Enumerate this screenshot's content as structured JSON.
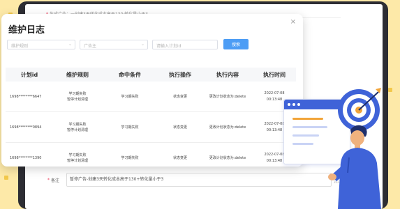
{
  "background_page": {
    "form_row_text": "生成广告：一创建3天转化成本高于130·转化量小于3",
    "remark_label": "备注",
    "remark_value": "暂停广告-创建3天转化成本高于130+转化量小于3",
    "year_hint": "2022"
  },
  "modal": {
    "title": "维护日志",
    "close_label": "×",
    "filters": {
      "rule_placeholder": "维护规则",
      "advertiser_placeholder": "广告主",
      "plan_id_placeholder": "请输入计划id",
      "search_label": "搜索"
    },
    "table": {
      "headers": [
        "计划id",
        "维护规则",
        "命中条件",
        "执行操作",
        "执行内容",
        "执行时间"
      ],
      "rows": [
        {
          "plan_id": "1698********6647",
          "rule_line1": "学习期失败",
          "rule_line2": "暂停计划清理",
          "condition": "学习期失败",
          "action": "状态变更",
          "content": "更改计划状态为:delete",
          "date": "2022-07-08",
          "time": "00:13:48"
        },
        {
          "plan_id": "1698********0894",
          "rule_line1": "学习期失败",
          "rule_line2": "暂停计划清理",
          "condition": "学习期失败",
          "action": "状态变更",
          "content": "更改计划状态为:delete",
          "date": "2022-07-08",
          "time": "00:13:48"
        },
        {
          "plan_id": "1698********1390",
          "rule_line1": "学习期失败",
          "rule_line2": "暂停计划清理",
          "condition": "学习期失败",
          "action": "状态变更",
          "content": "更改计划状态为:delete",
          "date": "2022-07-08",
          "time": "00:13:48"
        }
      ]
    }
  },
  "colors": {
    "background": "#fde9a8",
    "accent": "#4d9df5",
    "illustration_blue": "#3f63d8",
    "illustration_orange": "#f2a43a"
  },
  "icons": [
    "close-icon",
    "chevron-down-icon",
    "target-icon",
    "arrow-icon"
  ]
}
